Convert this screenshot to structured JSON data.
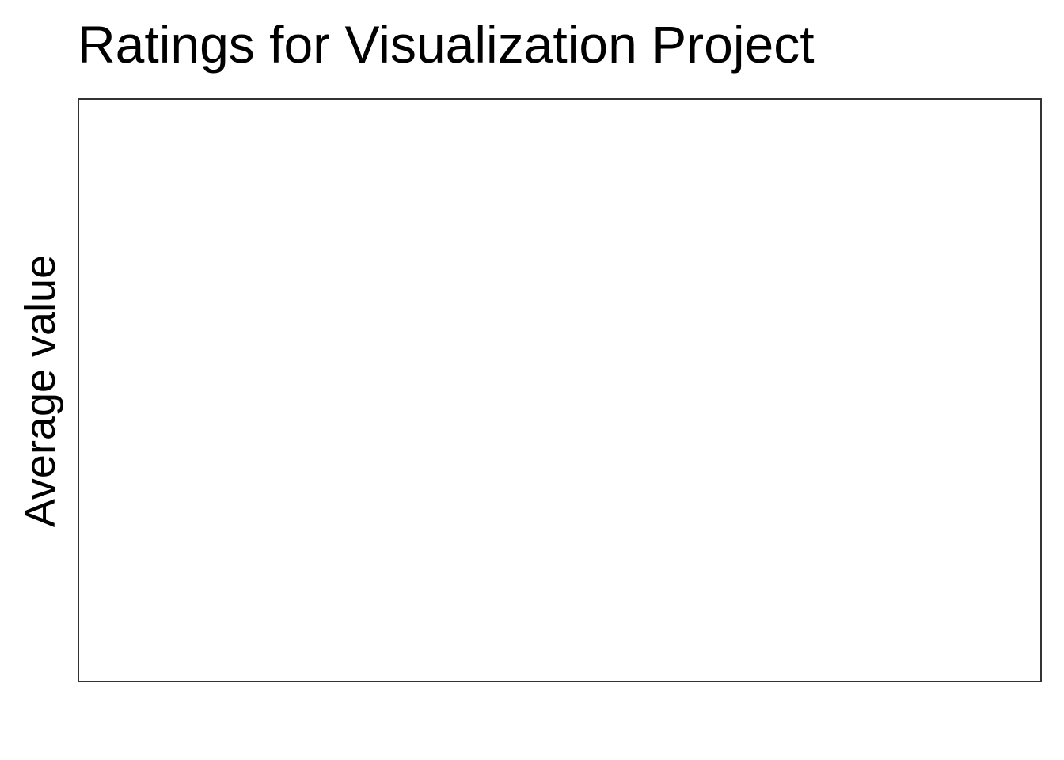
{
  "chart_data": {
    "type": "bar",
    "title": "Ratings for Visualization Project",
    "xlabel": "",
    "ylabel": "Average value",
    "categories": [],
    "values": [],
    "grid": false,
    "legend": "none",
    "panel_border_color": "#333333",
    "background_color": "#ffffff"
  }
}
